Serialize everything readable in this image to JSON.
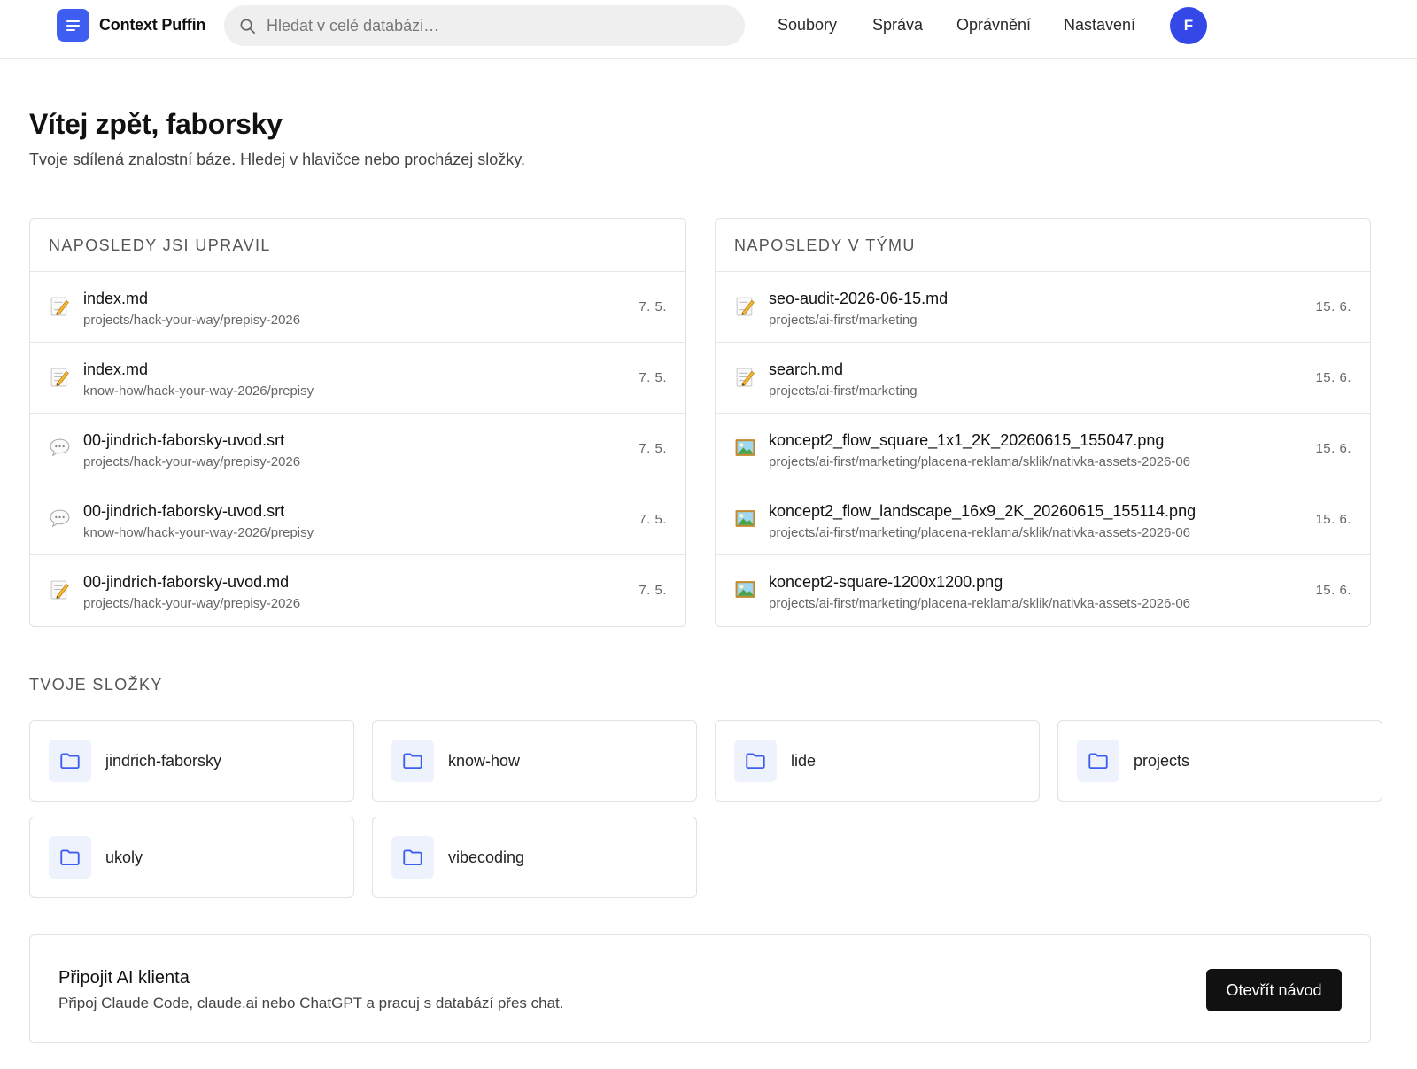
{
  "header": {
    "brand": "Context Puffin",
    "search_placeholder": "Hledat v celé databázi…",
    "nav": [
      "Soubory",
      "Správa",
      "Oprávnění",
      "Nastavení"
    ],
    "avatar_initial": "F",
    "accent_color": "#3d5ef0"
  },
  "welcome": {
    "title": "Vítej zpět, faborsky",
    "subtitle": "Tvoje sdílená znalostní báze. Hledej v hlavičce nebo procházej složky."
  },
  "recent_mine": {
    "heading": "NAPOSLEDY JSI UPRAVIL",
    "items": [
      {
        "icon": "memo-icon",
        "name": "index.md",
        "path": "projects/hack-your-way/prepisy-2026",
        "date": "7. 5."
      },
      {
        "icon": "memo-icon",
        "name": "index.md",
        "path": "know-how/hack-your-way-2026/prepisy",
        "date": "7. 5."
      },
      {
        "icon": "speech-bubble-icon",
        "name": "00-jindrich-faborsky-uvod.srt",
        "path": "projects/hack-your-way/prepisy-2026",
        "date": "7. 5."
      },
      {
        "icon": "speech-bubble-icon",
        "name": "00-jindrich-faborsky-uvod.srt",
        "path": "know-how/hack-your-way-2026/prepisy",
        "date": "7. 5."
      },
      {
        "icon": "memo-icon",
        "name": "00-jindrich-faborsky-uvod.md",
        "path": "projects/hack-your-way/prepisy-2026",
        "date": "7. 5."
      }
    ]
  },
  "recent_team": {
    "heading": "NAPOSLEDY V TÝMU",
    "items": [
      {
        "icon": "memo-icon",
        "name": "seo-audit-2026-06-15.md",
        "path": "projects/ai-first/marketing",
        "date": "15. 6."
      },
      {
        "icon": "memo-icon",
        "name": "search.md",
        "path": "projects/ai-first/marketing",
        "date": "15. 6."
      },
      {
        "icon": "image-icon",
        "name": "koncept2_flow_square_1x1_2K_20260615_155047.png",
        "path": "projects/ai-first/marketing/placena-reklama/sklik/nativka-assets-2026-06",
        "date": "15. 6."
      },
      {
        "icon": "image-icon",
        "name": "koncept2_flow_landscape_16x9_2K_20260615_155114.png",
        "path": "projects/ai-first/marketing/placena-reklama/sklik/nativka-assets-2026-06",
        "date": "15. 6."
      },
      {
        "icon": "image-icon",
        "name": "koncept2-square-1200x1200.png",
        "path": "projects/ai-first/marketing/placena-reklama/sklik/nativka-assets-2026-06",
        "date": "15. 6."
      }
    ]
  },
  "folders": {
    "heading": "TVOJE SLOŽKY",
    "items": [
      "jindrich-faborsky",
      "know-how",
      "lide",
      "projects",
      "ukoly",
      "vibecoding"
    ]
  },
  "ai_client": {
    "title": "Připojit AI klienta",
    "description": "Připoj Claude Code, claude.ai nebo ChatGPT a pracuj s databází přes chat.",
    "button": "Otevřít návod"
  }
}
